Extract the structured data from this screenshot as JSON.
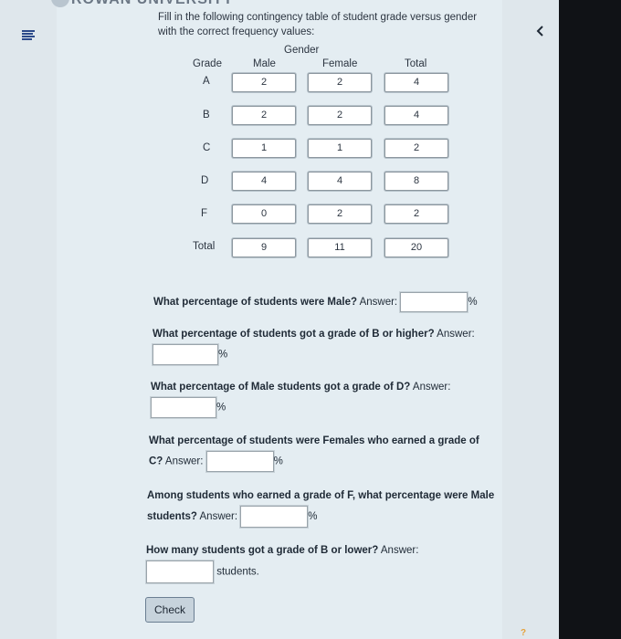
{
  "header": {
    "brand_cutoff": "ROWAN UNIVERSITY"
  },
  "instruction": "Fill in the following contingency table of student grade versus gender with the correct frequency values:",
  "table": {
    "group_label": "Gender",
    "row_header": "Grade",
    "columns": [
      "Male",
      "Female",
      "Total"
    ],
    "rows": [
      {
        "label": "A",
        "values": [
          "2",
          "2",
          "4"
        ]
      },
      {
        "label": "B",
        "values": [
          "2",
          "2",
          "4"
        ]
      },
      {
        "label": "C",
        "values": [
          "1",
          "1",
          "2"
        ]
      },
      {
        "label": "D",
        "values": [
          "4",
          "4",
          "8"
        ]
      },
      {
        "label": "F",
        "values": [
          "0",
          "2",
          "2"
        ]
      },
      {
        "label": "Total",
        "values": [
          "9",
          "11",
          "20"
        ]
      }
    ]
  },
  "questions": [
    {
      "bold": "What percentage of students were Male?",
      "prompt": "Answer:",
      "suffix": "%"
    },
    {
      "bold": "What percentage of students got a grade of B or higher?",
      "prompt": "Answer:",
      "suffix": "%"
    },
    {
      "bold": "What percentage of Male students got a grade of D?",
      "prompt": "Answer:",
      "suffix": "%"
    },
    {
      "bold": "What percentage of students were Females who earned a grade of C?",
      "prompt": "Answer:",
      "suffix": "%"
    },
    {
      "bold": "Among students who earned a grade of F, what percentage were Male students?",
      "prompt": "Answer:",
      "suffix": "%"
    },
    {
      "bold": "How many students got a grade of B or lower?",
      "prompt": "Answer:",
      "suffix": "students."
    }
  ],
  "check_label": "Check",
  "colors": {
    "panel": "#e4edf2",
    "sidebar": "#dfe7ec",
    "menu_icon": "#2c4a8a",
    "bezel": "#101216"
  },
  "icons": {
    "menu": "menu-icon",
    "back": "chevron-left-icon"
  }
}
